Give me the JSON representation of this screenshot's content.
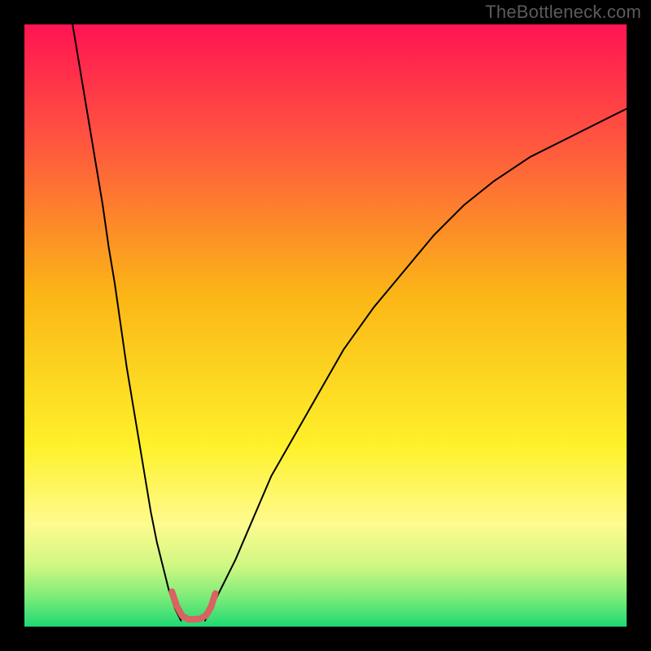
{
  "watermark": "TheBottleneck.com",
  "chart_data": {
    "type": "line",
    "title": "",
    "xlabel": "",
    "ylabel": "",
    "xlim": [
      0,
      100
    ],
    "ylim": [
      0,
      100
    ],
    "grid": false,
    "legend": false,
    "gradient_stops": [
      {
        "offset": 0,
        "color": "#ff1452"
      },
      {
        "offset": 0.19,
        "color": "#ff5440"
      },
      {
        "offset": 0.45,
        "color": "#fbb616"
      },
      {
        "offset": 0.7,
        "color": "#fef12b"
      },
      {
        "offset": 0.83,
        "color": "#fefb8f"
      },
      {
        "offset": 0.9,
        "color": "#cef783"
      },
      {
        "offset": 0.95,
        "color": "#7eec78"
      },
      {
        "offset": 1.0,
        "color": "#1fd973"
      }
    ],
    "series": [
      {
        "name": "curve-left",
        "color": "#000000",
        "width": 2,
        "x": [
          8,
          9,
          10,
          11,
          12,
          13,
          14,
          15,
          16,
          17,
          18,
          19,
          20,
          21,
          22,
          23,
          24,
          25,
          26
        ],
        "y": [
          100,
          94,
          88,
          82,
          76,
          70,
          63,
          57,
          50,
          43,
          37,
          31,
          25,
          19,
          14,
          10,
          6,
          3,
          1
        ]
      },
      {
        "name": "curve-right",
        "color": "#000000",
        "width": 2,
        "x": [
          30,
          32,
          35,
          38,
          41,
          45,
          49,
          53,
          58,
          63,
          68,
          73,
          78,
          84,
          90,
          96,
          100
        ],
        "y": [
          1,
          5,
          11,
          18,
          25,
          32,
          39,
          46,
          53,
          59,
          65,
          70,
          74,
          78,
          81,
          84,
          86
        ]
      },
      {
        "name": "highlight-segment",
        "color": "#d96262",
        "width": 8,
        "x": [
          24.5,
          25.3,
          26.2,
          27.2,
          28.2,
          29.2,
          30.2,
          31.0,
          31.7
        ],
        "y": [
          5.8,
          3.4,
          1.8,
          1.2,
          1.2,
          1.3,
          1.9,
          3.3,
          5.5
        ]
      }
    ]
  }
}
